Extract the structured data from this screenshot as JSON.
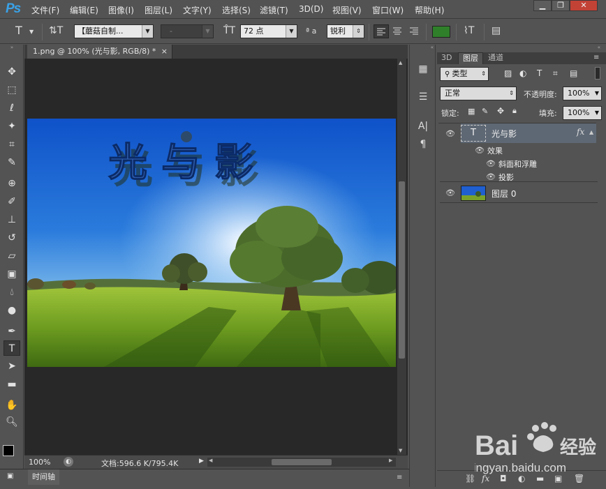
{
  "app": {
    "logo": "Ps"
  },
  "menu": [
    "文件(F)",
    "编辑(E)",
    "图像(I)",
    "图层(L)",
    "文字(Y)",
    "选择(S)",
    "滤镜(T)",
    "3D(D)",
    "视图(V)",
    "窗口(W)",
    "帮助(H)"
  ],
  "window_controls": {
    "minimize": "▁",
    "maximize": "❐",
    "close": "✕"
  },
  "options": {
    "font_family": "【蘑菇自制...",
    "font_style": "-",
    "font_size": "72 点",
    "aa_label": "ª a",
    "antialias": "锐利",
    "color": "#2f7f2a"
  },
  "document": {
    "tab_title": "1.png @ 100% (光与影, RGB/8) *",
    "tab_close": "×",
    "canvas_text": "光与影",
    "zoom": "100%",
    "doc_info": "文档:596.6 K/795.4K"
  },
  "timeline": {
    "label": "时间轴"
  },
  "panel": {
    "tabs": [
      "3D",
      "图层",
      "通道"
    ],
    "filter_kind": "类型",
    "blend_mode": "正常",
    "opacity_label": "不透明度:",
    "opacity": "100%",
    "lock_label": "锁定:",
    "fill_label": "填充:",
    "fill": "100%",
    "layers": [
      {
        "name": "光与影",
        "kind": "T",
        "fx": "fx"
      },
      {
        "name": "图层 0",
        "kind": "image"
      }
    ],
    "effects_label": "效果",
    "effects": [
      "斜面和浮雕",
      "投影"
    ]
  },
  "watermark": {
    "brand": "Bai",
    "suffix": "经验",
    "url": "jingyan.baidu.com"
  }
}
